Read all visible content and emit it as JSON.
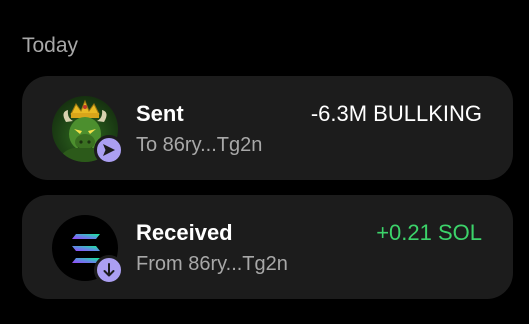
{
  "section": {
    "title": "Today"
  },
  "colors": {
    "background": "#000000",
    "card": "#1c1c1c",
    "badge": "#ab9ff2",
    "positive": "#3cd36a",
    "muted": "#a8a8a8"
  },
  "transactions": [
    {
      "type_label": "Sent",
      "counterparty": "To 86ry...Tg2n",
      "amount": "-6.3M BULLKING",
      "token_icon": "bullking-token-icon",
      "badge_icon": "send-arrow-icon"
    },
    {
      "type_label": "Received",
      "counterparty": "From 86ry...Tg2n",
      "amount": "+0.21 SOL",
      "token_icon": "solana-token-icon",
      "badge_icon": "receive-arrow-icon"
    }
  ]
}
